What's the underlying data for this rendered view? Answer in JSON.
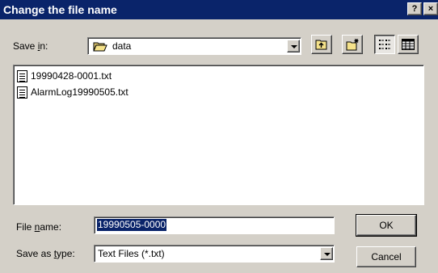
{
  "window": {
    "title": "Change the file name",
    "help_button": "?",
    "close_button": "×"
  },
  "save_in": {
    "label_pre": "Save ",
    "label_accel": "i",
    "label_post": "n:",
    "folder": "data"
  },
  "toolbar": {
    "up_folder": "folder-up-icon",
    "new_folder": "new-folder-icon",
    "list_view": "list-view-icon",
    "details_view": "details-view-icon"
  },
  "files": [
    {
      "name": "19990428-0001.txt",
      "icon": "text-file-icon"
    },
    {
      "name": "AlarmLog19990505.txt",
      "icon": "text-file-icon"
    }
  ],
  "file_name": {
    "label_pre": "File ",
    "label_accel": "n",
    "label_post": "ame:",
    "value": "19990505-0000"
  },
  "save_as_type": {
    "label_pre": "Save as ",
    "label_accel": "t",
    "label_post": "ype:",
    "value": "Text Files (*.txt)"
  },
  "buttons": {
    "ok": "OK",
    "cancel": "Cancel"
  }
}
